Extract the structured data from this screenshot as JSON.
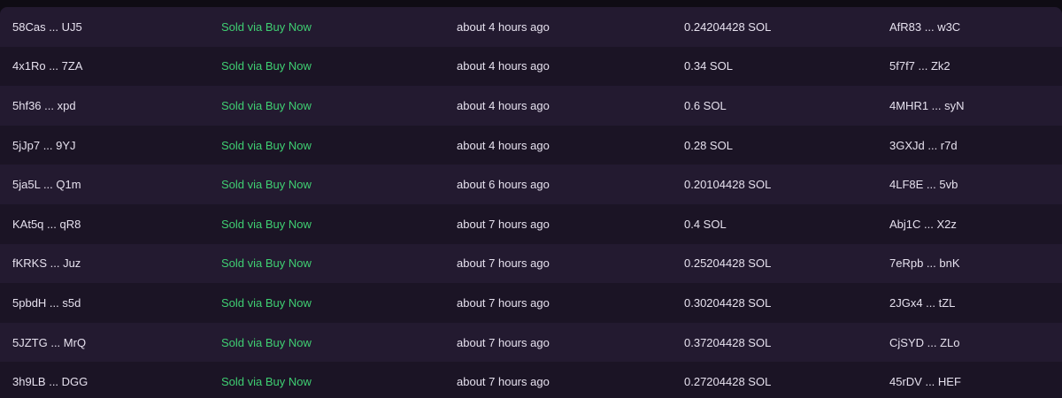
{
  "colors": {
    "background": "#0f0c14",
    "row_odd": "#231a30",
    "row_even": "#1b1425",
    "text": "#e6e1ee",
    "status": "#3fcf72"
  },
  "activity": {
    "rows": [
      {
        "signature": "58Cas ... UJ5",
        "status": "Sold via Buy Now",
        "time": "about 4 hours ago",
        "price": "0.24204428 SOL",
        "buyer": "AfR83 ... w3C"
      },
      {
        "signature": "4x1Ro ... 7ZA",
        "status": "Sold via Buy Now",
        "time": "about 4 hours ago",
        "price": "0.34 SOL",
        "buyer": "5f7f7 ... Zk2"
      },
      {
        "signature": "5hf36 ... xpd",
        "status": "Sold via Buy Now",
        "time": "about 4 hours ago",
        "price": "0.6 SOL",
        "buyer": "4MHR1 ... syN"
      },
      {
        "signature": "5jJp7 ... 9YJ",
        "status": "Sold via Buy Now",
        "time": "about 4 hours ago",
        "price": "0.28 SOL",
        "buyer": "3GXJd ... r7d"
      },
      {
        "signature": "5ja5L ... Q1m",
        "status": "Sold via Buy Now",
        "time": "about 6 hours ago",
        "price": "0.20104428 SOL",
        "buyer": "4LF8E ... 5vb"
      },
      {
        "signature": "KAt5q ... qR8",
        "status": "Sold via Buy Now",
        "time": "about 7 hours ago",
        "price": "0.4 SOL",
        "buyer": "Abj1C ... X2z"
      },
      {
        "signature": "fKRKS ... Juz",
        "status": "Sold via Buy Now",
        "time": "about 7 hours ago",
        "price": "0.25204428 SOL",
        "buyer": "7eRpb ... bnK"
      },
      {
        "signature": "5pbdH ... s5d",
        "status": "Sold via Buy Now",
        "time": "about 7 hours ago",
        "price": "0.30204428 SOL",
        "buyer": "2JGx4 ... tZL"
      },
      {
        "signature": "5JZTG ... MrQ",
        "status": "Sold via Buy Now",
        "time": "about 7 hours ago",
        "price": "0.37204428 SOL",
        "buyer": "CjSYD ... ZLo"
      },
      {
        "signature": "3h9LB ... DGG",
        "status": "Sold via Buy Now",
        "time": "about 7 hours ago",
        "price": "0.27204428 SOL",
        "buyer": "45rDV ... HEF"
      }
    ]
  }
}
